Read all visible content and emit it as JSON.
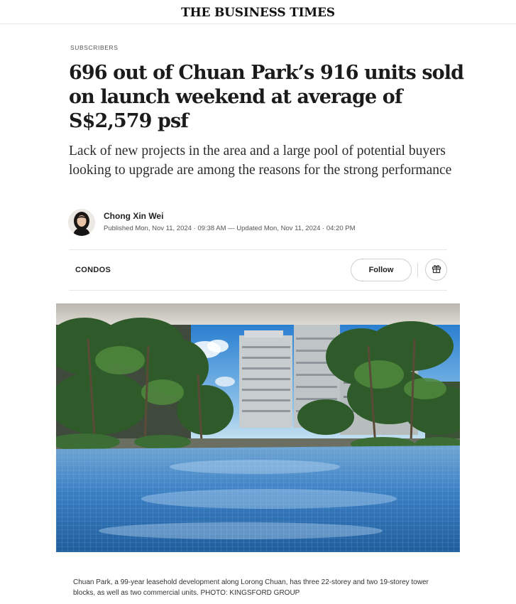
{
  "masthead": {
    "logo_text": "THE BUSINESS TIMES"
  },
  "article": {
    "kicker": "SUBSCRIBERS",
    "headline": "696 out of Chuan Park’s 916 units sold on launch weekend at average of S$2,579 psf",
    "deck": "Lack of new projects in the area and a large pool of potential buyers looking to upgrade are among the reasons for the strong performance",
    "author": "Chong Xin Wei",
    "published": "Published Mon, Nov 11, 2024 · 09:38 AM — Updated Mon, Nov 11, 2024 · 04:20 PM",
    "topic": "CONDOS",
    "follow_label": "Follow",
    "gift_icon": "gift-icon",
    "image_caption": "Chuan Park, a 99-year leasehold development along Lorong Chuan, has three 22-storey and two 19-storey tower blocks, as well as two commercial units. PHOTO: KINGSFORD GROUP"
  },
  "colors": {
    "text": "#1b1b1b",
    "muted": "#555555",
    "border": "#e6e6e6",
    "pool_blue": "#3a7fc4",
    "sky_blue": "#2f86d6"
  }
}
